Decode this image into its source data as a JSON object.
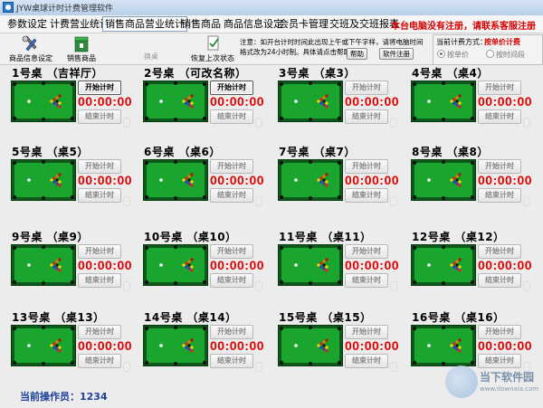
{
  "window": {
    "title": "JYW桌球计时计费管理软件"
  },
  "menu": {
    "items": [
      "参数设定",
      "计费营业统计",
      "销售商品营业统计",
      "销售商品",
      "商品信息设定",
      "会员卡管理",
      "交班及交班报表"
    ],
    "active_index": 2,
    "warning": "本台电脑没有注册，请联系客服注册"
  },
  "toolbar": {
    "product_settings": "商品信息设定",
    "sell_product": "销售商品",
    "switch_table": "换桌",
    "restore_state": "恢复上次状态",
    "notice_line1": "注意：如开台计时时间此出现上午或下午字样，请将电脑时间",
    "notice_line2": "格式改为24小时制。具体请点击帮助",
    "help_button": "帮助",
    "register_button": "软件注册",
    "calc_label": "当前计费方式：",
    "calc_value": "按单价计费",
    "radio_unit": "按单价",
    "radio_period": "按时间段",
    "colors": {
      "warning": "#d40000",
      "timer": "#e00000",
      "felt": "#1aa52f"
    }
  },
  "tables": [
    {
      "name": "1号桌  （吉祥厅）",
      "start": "开始计时",
      "end": "结束计时",
      "time": "00:00:00",
      "active": true
    },
    {
      "name": "2号桌  （可改名称）",
      "start": "开始计时",
      "end": "结束计时",
      "time": "00:00:00",
      "active": true
    },
    {
      "name": "3号桌  （桌3）",
      "start": "开始计时",
      "end": "结束计时",
      "time": "00:00:00",
      "active": false
    },
    {
      "name": "4号桌  （桌4）",
      "start": "开始计时",
      "end": "结束计时",
      "time": "00:00:00",
      "active": false
    },
    {
      "name": "5号桌  （桌5）",
      "start": "开始计时",
      "end": "结束计时",
      "time": "00:00:00",
      "active": false
    },
    {
      "name": "6号桌  （桌6）",
      "start": "开始计时",
      "end": "结束计时",
      "time": "00:00:00",
      "active": false
    },
    {
      "name": "7号桌  （桌7）",
      "start": "开始计时",
      "end": "结束计时",
      "time": "00:00:00",
      "active": false
    },
    {
      "name": "8号桌  （桌8）",
      "start": "开始计时",
      "end": "结束计时",
      "time": "00:00:00",
      "active": false
    },
    {
      "name": "9号桌  （桌9）",
      "start": "开始计时",
      "end": "结束计时",
      "time": "00:00:00",
      "active": false
    },
    {
      "name": "10号桌  （桌10）",
      "start": "开始计时",
      "end": "结束计时",
      "time": "00:00:00",
      "active": false
    },
    {
      "name": "11号桌  （桌11）",
      "start": "开始计时",
      "end": "结束计时",
      "time": "00:00:00",
      "active": false
    },
    {
      "name": "12号桌  （桌12）",
      "start": "开始计时",
      "end": "结束计时",
      "time": "00:00:00",
      "active": false
    },
    {
      "name": "13号桌  （桌13）",
      "start": "开始计时",
      "end": "结束计时",
      "time": "00:00:00",
      "active": false
    },
    {
      "name": "14号桌  （桌14）",
      "start": "开始计时",
      "end": "结束计时",
      "time": "00:00:00",
      "active": false
    },
    {
      "name": "15号桌  （桌15）",
      "start": "开始计时",
      "end": "结束计时",
      "time": "00:00:00",
      "active": false
    },
    {
      "name": "16号桌  （桌16）",
      "start": "开始计时",
      "end": "结束计时",
      "time": "00:00:00",
      "active": false
    }
  ],
  "status": {
    "operator": "当前操作员：1234"
  },
  "watermark": {
    "text": "当下软件园",
    "url": "www.downxia.com"
  }
}
